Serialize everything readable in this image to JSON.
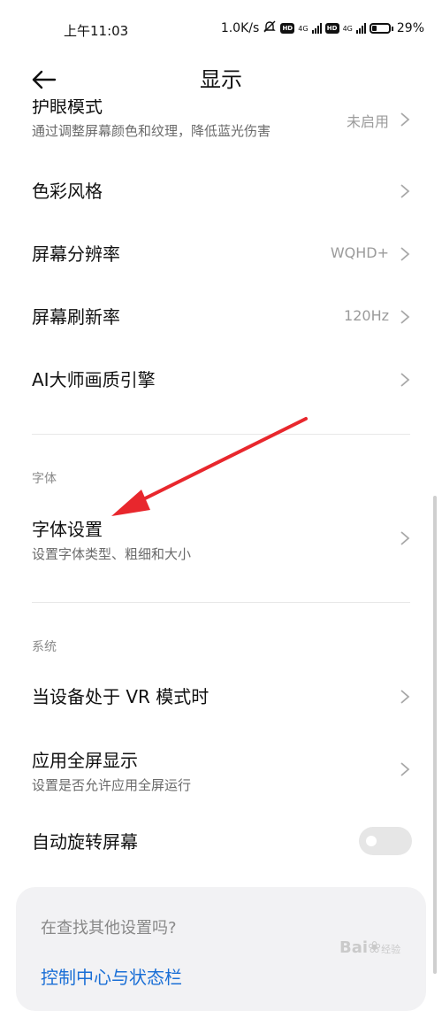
{
  "status_bar": {
    "time": "上午11:03",
    "speed": "1.0K/s",
    "net1": "4G",
    "net2": "4G",
    "battery_percent": "29%",
    "battery_level": 0.29
  },
  "header": {
    "title": "显示"
  },
  "rows": {
    "eye_care": {
      "title": "护眼模式",
      "subtitle": "通过调整屏幕颜色和纹理，降低蓝光伤害",
      "value": "未启用"
    },
    "color_style": {
      "title": "色彩风格"
    },
    "resolution": {
      "title": "屏幕分辨率",
      "value": "WQHD+"
    },
    "refresh_rate": {
      "title": "屏幕刷新率",
      "value": "120Hz"
    },
    "ai_engine": {
      "title": "AI大师画质引擎"
    },
    "font_settings": {
      "title": "字体设置",
      "subtitle": "设置字体类型、粗细和大小"
    },
    "vr_mode": {
      "title": "当设备处于 VR 模式时"
    },
    "fullscreen_apps": {
      "title": "应用全屏显示",
      "subtitle": "设置是否允许应用全屏运行"
    },
    "auto_rotate": {
      "title": "自动旋转屏幕",
      "enabled": false
    }
  },
  "sections": {
    "font": "字体",
    "system": "系统"
  },
  "search_card": {
    "title": "在查找其他设置吗?",
    "link": "控制中心与状态栏"
  },
  "watermark": {
    "brand": "Bai",
    "sub": "经验"
  },
  "colors": {
    "accent": "#1a6fd6",
    "annotation": "#e8272d"
  }
}
